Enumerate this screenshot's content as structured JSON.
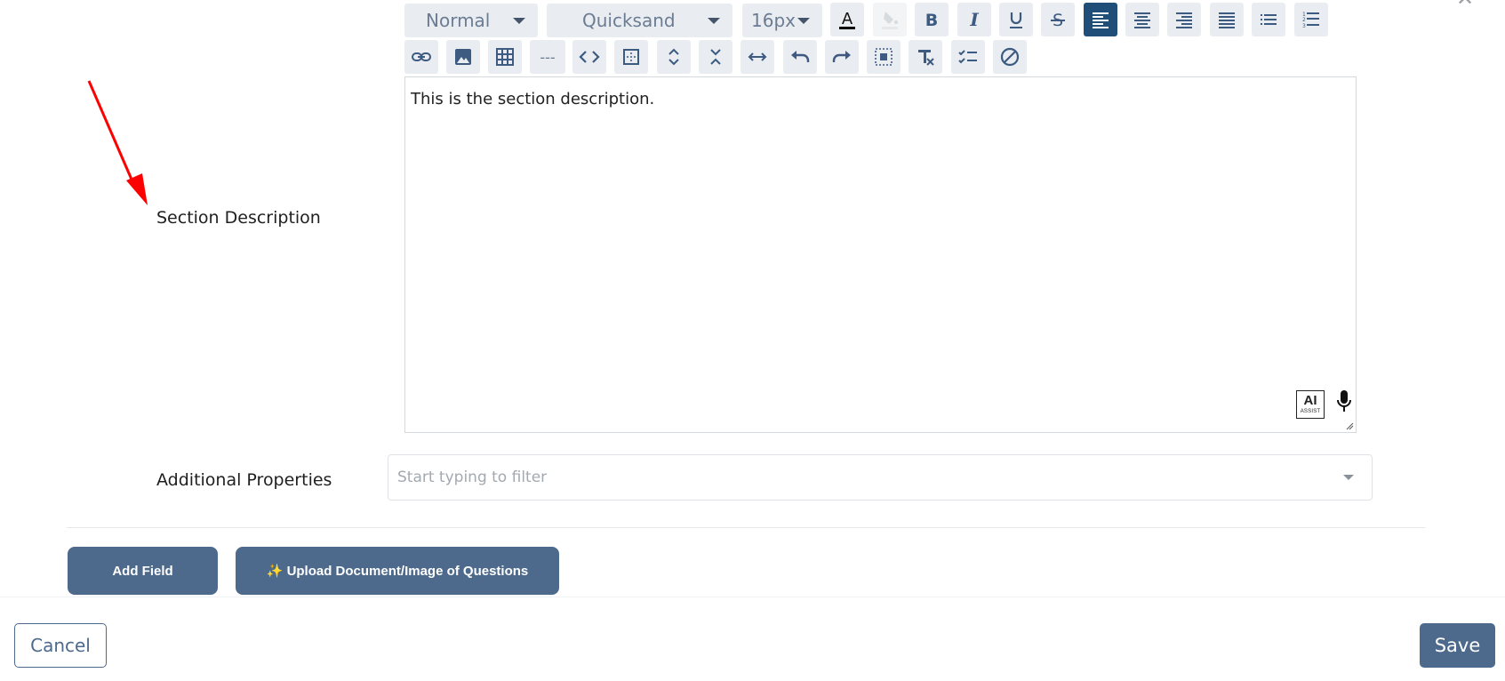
{
  "toolbar": {
    "block_format": "Normal",
    "font_family": "Quicksand",
    "font_size": "16px",
    "horizontal_rule": "---",
    "active_color": "#1f4e79",
    "button_bg": "#e9edf1"
  },
  "form": {
    "section_description_label": "Section Description",
    "section_description_value": "This is the section description.",
    "additional_properties_label": "Additional Properties",
    "additional_properties_placeholder": "Start typing to filter"
  },
  "editor": {
    "ai_badge_main": "AI",
    "ai_badge_sub": "ASSIST"
  },
  "actions": {
    "add_field": "Add Field",
    "upload": "✨ Upload Document/Image of Questions",
    "cancel": "Cancel",
    "save": "Save",
    "primary_color": "#4d6a8c"
  }
}
